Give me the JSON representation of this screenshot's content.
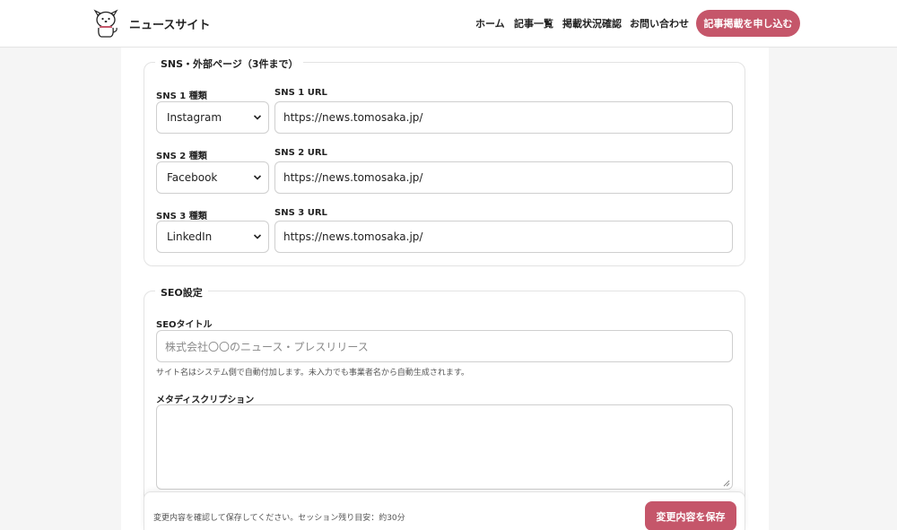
{
  "header": {
    "site_title": "ニュースサイト",
    "nav": {
      "home": "ホーム",
      "articles": "記事一覧",
      "status": "掲載状況確認",
      "contact": "お問い合わせ"
    },
    "cta_label": "記事掲載を申し込む"
  },
  "sns_section": {
    "legend": "SNS・外部ページ（3件まで）",
    "rows": [
      {
        "type_label": "SNS 1 種類",
        "type_value": "Instagram",
        "url_label": "SNS 1 URL",
        "url_value": "https://news.tomosaka.jp/"
      },
      {
        "type_label": "SNS 2 種類",
        "type_value": "Facebook",
        "url_label": "SNS 2 URL",
        "url_value": "https://news.tomosaka.jp/"
      },
      {
        "type_label": "SNS 3 種類",
        "type_value": "LinkedIn",
        "url_label": "SNS 3 URL",
        "url_value": "https://news.tomosaka.jp/"
      }
    ]
  },
  "seo_section": {
    "legend": "SEO設定",
    "title_label": "SEOタイトル",
    "title_placeholder": "株式会社〇〇のニュース・プレスリリース",
    "title_help": "サイト名はシステム側で自動付加します。未入力でも事業者名から自動生成されます。",
    "description_label": "メタディスクリプション",
    "description_value": ""
  },
  "footer": {
    "note": "変更内容を確認して保存してください。セッション残り目安：約30分",
    "save_label": "変更内容を保存"
  },
  "colors": {
    "accent": "#c5566a",
    "border": "#cfcfcf",
    "background": "#f5f5f5"
  }
}
